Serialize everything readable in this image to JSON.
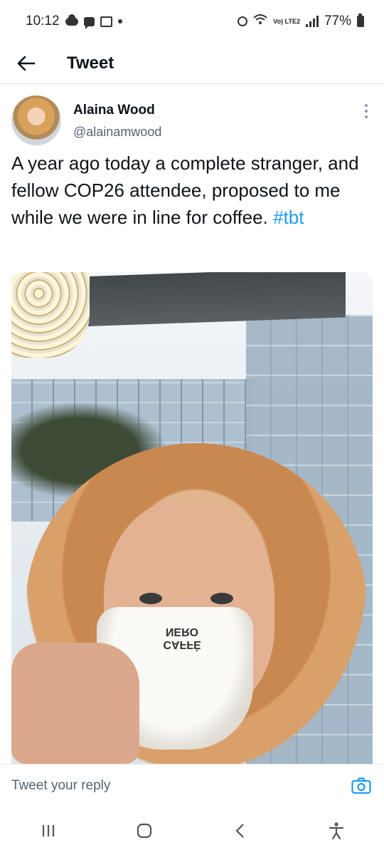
{
  "status_bar": {
    "time": "10:12",
    "network_label": "Vo) LTE2",
    "battery": "77%"
  },
  "header": {
    "title": "Tweet"
  },
  "tweet": {
    "author_name": "Alaina Wood",
    "author_handle": "@alainamwood",
    "text": "A year ago today a complete stranger, and fellow COP26 attendee, proposed to me while we were in line for coffee.",
    "hashtag": "#tbt",
    "media_cup_text": "CAFFÈ NERO"
  },
  "reply": {
    "placeholder": "Tweet your reply"
  },
  "icons": {
    "back": "arrow-left-icon",
    "more": "more-vertical-icon",
    "camera": "camera-icon",
    "nav_recents": "recents-icon",
    "nav_home": "home-icon",
    "nav_back": "chevron-left-icon",
    "nav_accessibility": "accessibility-icon"
  },
  "colors": {
    "hashtag": "#1d9bf0",
    "handle": "#536471",
    "text": "#0f1419"
  }
}
